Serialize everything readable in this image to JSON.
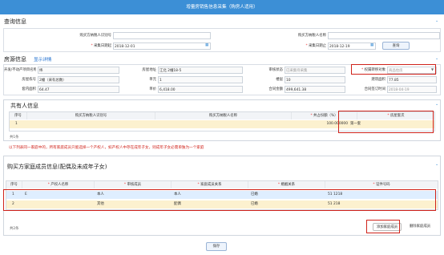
{
  "window": {
    "title": "增量房销售信息采集（购房人适用）"
  },
  "query": {
    "section_title": "查询信息",
    "buyer_id_label": "购买方纳税人识别号",
    "buyer_id_value": "",
    "buyer_name_label": "购买方纳税人名称",
    "buyer_name_value": "",
    "start_label": "采集日期起",
    "start_value": "2018-12-01",
    "end_label": "采集日期止",
    "end_value": "2018-12-19",
    "query_button": "查询"
  },
  "house": {
    "section_title": "房源信息",
    "detail_link": "显示详情",
    "rows": [
      [
        {
          "label": "开发/不动产项目名称",
          "value": "纬"
        },
        {
          "label": "房屋地址",
          "value": "江北                  2幢18-5"
        },
        {
          "label": "审核状态",
          "value": "已采集待采集"
        },
        {
          "label": "权属转移对象",
          "value": "商品住房"
        }
      ],
      [
        {
          "label": "房屋栋号",
          "value": "2幢（采有总数）"
        },
        {
          "label": "单元",
          "value": "1"
        },
        {
          "label": "楼层",
          "value": "10"
        },
        {
          "label": "建筑面积",
          "value": "77.85"
        }
      ],
      [
        {
          "label": "套内面积",
          "value": "64.47"
        },
        {
          "label": "单价",
          "value": "6,418.00"
        },
        {
          "label": "合同金额",
          "value": "499,641.38"
        },
        {
          "label": "合同签订时间",
          "value": "2018-04-19"
        }
      ]
    ]
  },
  "co_owners": {
    "section_title": "共有人信息",
    "headers": [
      "序号",
      "购买方纳税人识别号",
      "购买方纳税人名称",
      "共占份额（%）",
      "房屋套次"
    ],
    "rows": [
      {
        "index": "1",
        "id": "",
        "name": "",
        "share": "100.000000",
        "times": "第一套"
      }
    ],
    "count": "共1条"
  },
  "notice": "以下列表同一家庭中的，所有家庭成员只能选择一个产权人，如产权人中存在成年子女，则成年子女必需单独为一个家庭",
  "family": {
    "section_title": "购买方家庭成员信息(配偶及未成年子女)",
    "headers": [
      "序号",
      "产权人名称",
      "审核成员",
      "家庭成员关系",
      "婚姻关系",
      "证件号码"
    ],
    "rows": [
      {
        "index": "1",
        "name": "E",
        "member": "本人",
        "relation": "本人",
        "marriage": "已婚",
        "id": "51                    1218"
      },
      {
        "index": "2",
        "name": "",
        "member": "其他",
        "relation": "配偶",
        "marriage": "已婚",
        "id": "51                     218"
      }
    ],
    "count": "共2条",
    "add_button": "添加家庭成员",
    "delete_button": "删除家庭成员"
  },
  "save_button": "保存"
}
